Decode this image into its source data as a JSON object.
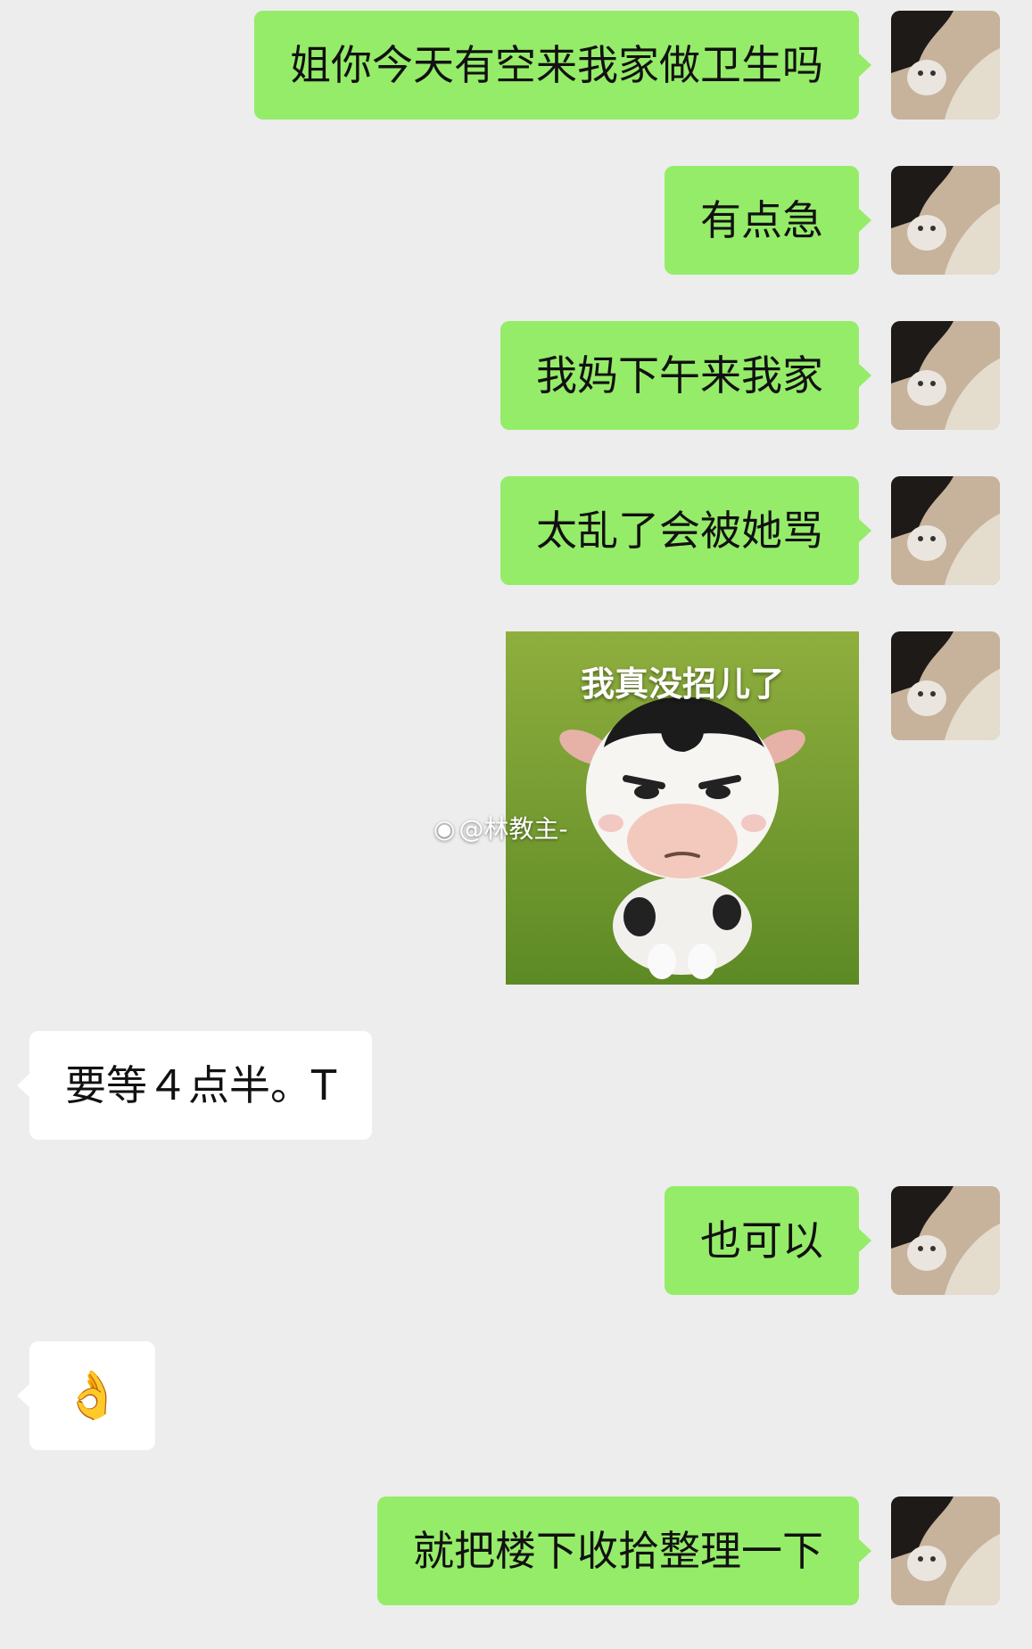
{
  "messages": [
    {
      "text": "姐你今天有空来我家做卫生吗"
    },
    {
      "text": "有点急"
    },
    {
      "text": "我妈下午来我家"
    },
    {
      "text": "太乱了会被她骂"
    },
    {
      "sticker_caption": "我真没招儿了"
    },
    {
      "text": "要等４点半。T"
    },
    {
      "text": "也可以"
    },
    {
      "emoji": "👌"
    },
    {
      "text": "就把楼下收拾整理一下"
    }
  ],
  "watermark": {
    "icon": "weibo-icon",
    "text": "@林教主-"
  },
  "colors": {
    "background": "#ededed",
    "outgoing_bubble": "#95ec69",
    "incoming_bubble": "#ffffff"
  }
}
